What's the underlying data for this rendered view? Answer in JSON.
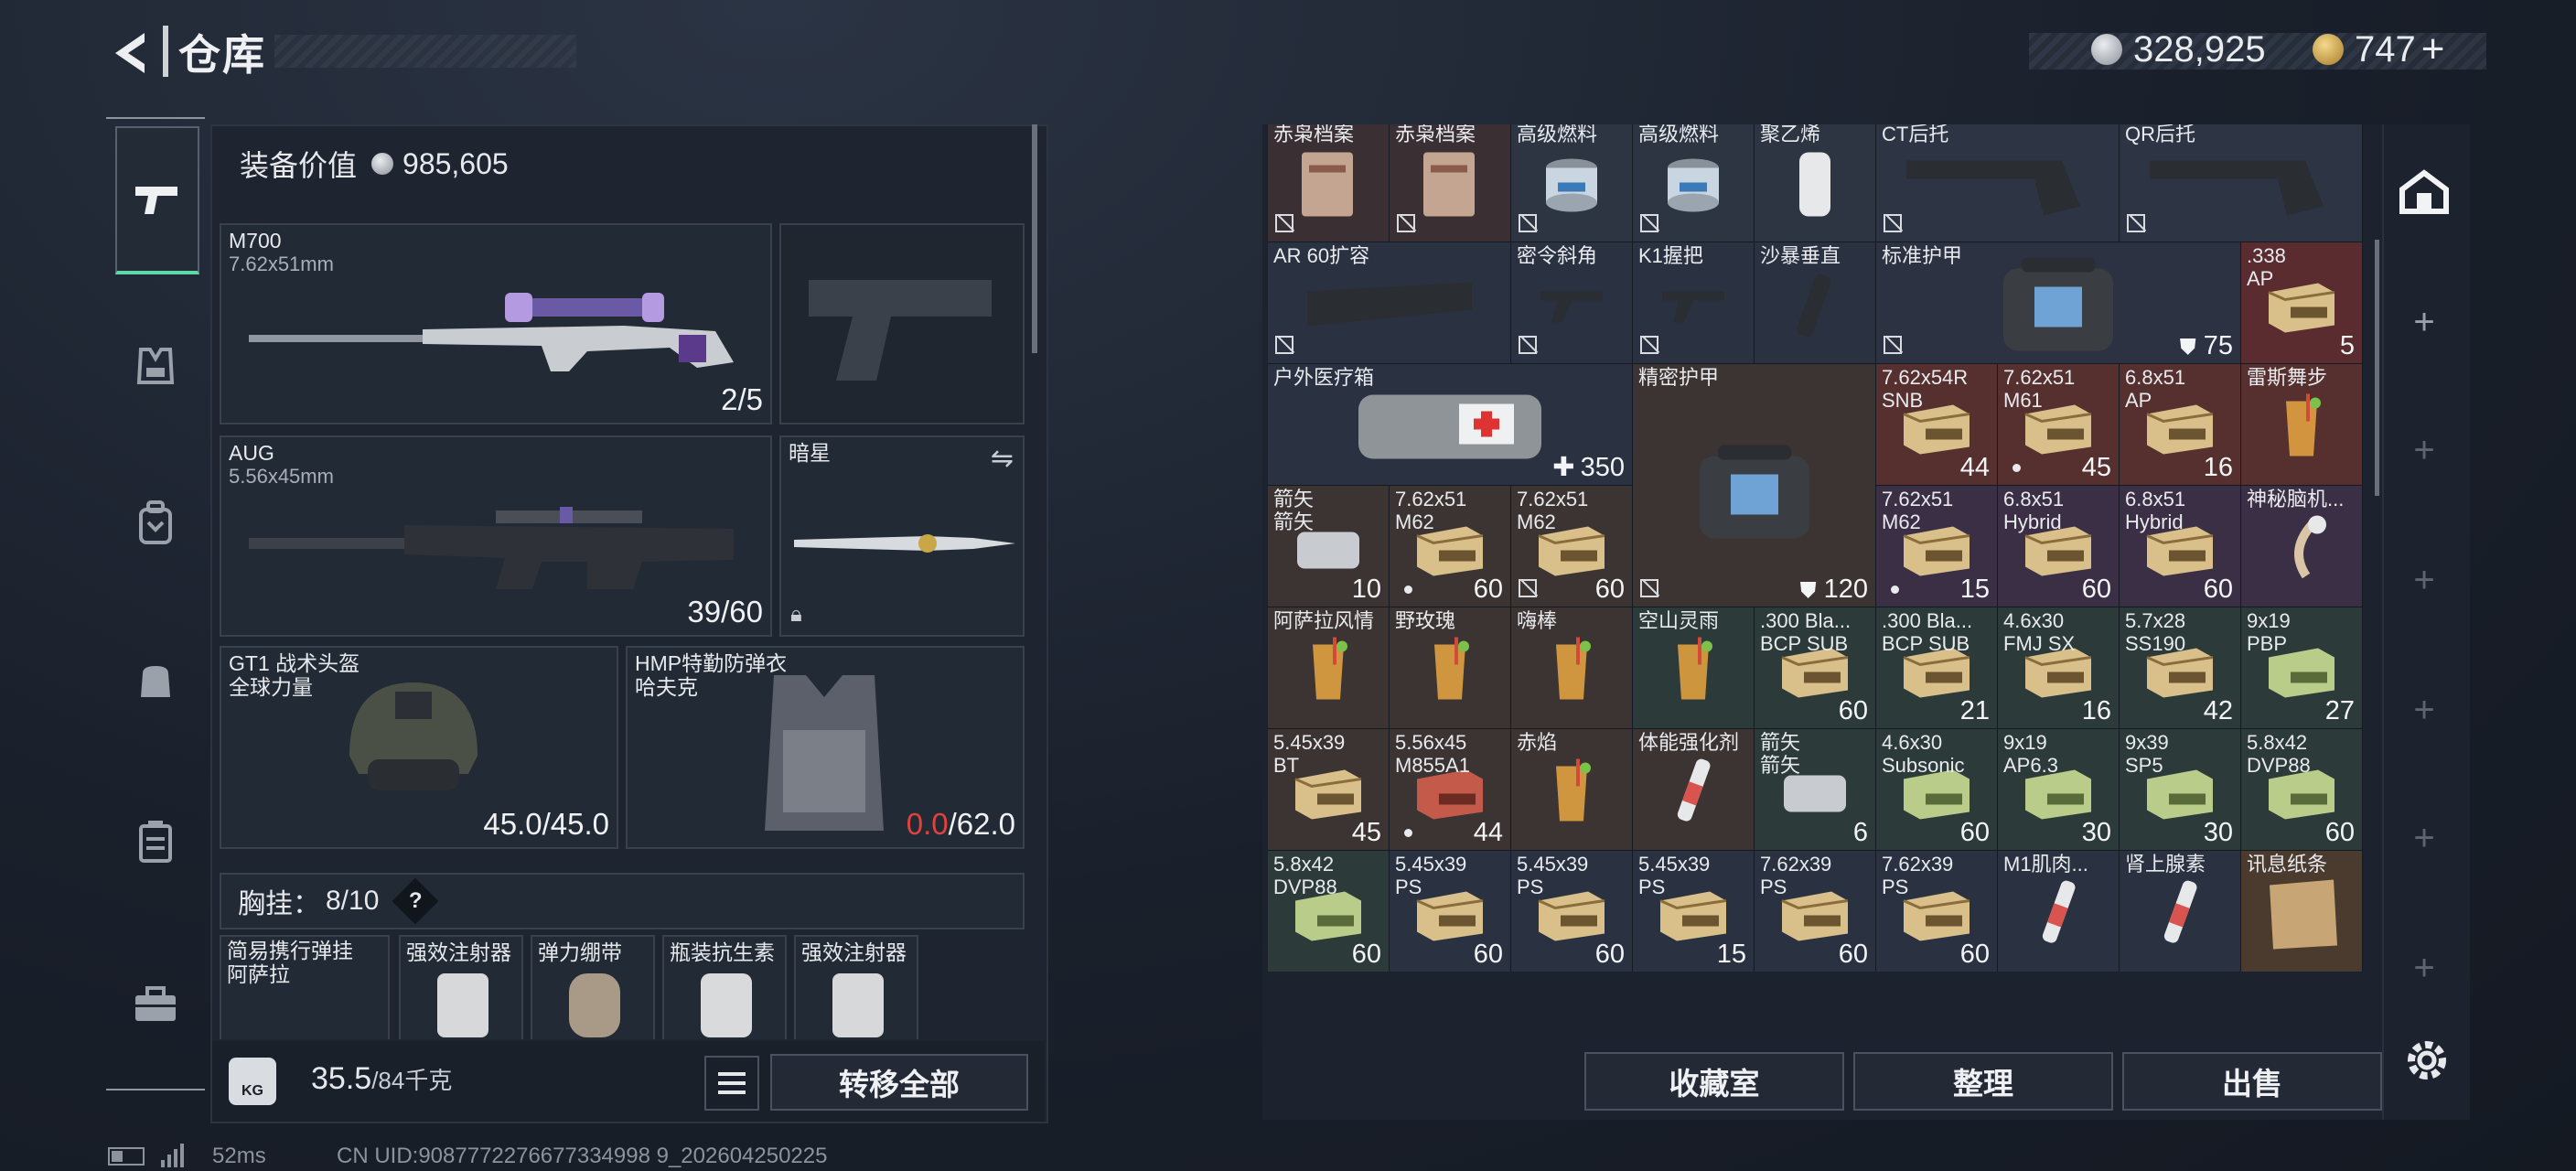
{
  "header": {
    "title": "仓库",
    "currency": {
      "silver": "328,925",
      "gold": "747",
      "plus": "+"
    }
  },
  "gear": {
    "value_label": "装备价值",
    "value": "985,605",
    "primary": {
      "name": "M700",
      "caliber": "7.62x51mm",
      "ammo": "2/5"
    },
    "secondary": {
      "name": "AUG",
      "caliber": "5.56x45mm",
      "ammo": "39/60"
    },
    "melee": {
      "name": "暗星"
    },
    "helmet": {
      "name": "GT1 战术头盔",
      "sub": "全球力量",
      "durability": "45.0/45.0"
    },
    "armor": {
      "name": "HMP特勤防弹衣",
      "sub": "哈夫克",
      "durability_current": "0.0",
      "durability_max": "/62.0"
    },
    "rig": {
      "label": "胸挂：",
      "value": "8/10",
      "help": "?"
    },
    "rig_items": [
      {
        "name": "简易携行弹挂\n阿萨拉"
      },
      {
        "name": "强效注射器"
      },
      {
        "name": "弹力绷带"
      },
      {
        "name": "瓶装抗生素"
      },
      {
        "name": "强效注射器"
      }
    ],
    "weight": "35.5",
    "weight_max": "/84千克",
    "transfer_all": "转移全部"
  },
  "inventory": {
    "rows": [
      [
        {
          "l": "赤枭档案",
          "c": "",
          "m": true,
          "bg": "#3a3034",
          "ico": "doc"
        },
        {
          "l": "赤枭档案",
          "c": "",
          "m": true,
          "bg": "#3a3034",
          "ico": "doc"
        },
        {
          "l": "高级燃料",
          "c": "",
          "m": true,
          "bg": "#2d3542",
          "ico": "can"
        },
        {
          "l": "高级燃料",
          "c": "",
          "m": true,
          "bg": "#2d3542",
          "ico": "can"
        },
        {
          "l": "聚乙烯",
          "c": "",
          "m": false,
          "bg": "#2d3542",
          "ico": "roll"
        },
        {
          "l": "CT后托",
          "c": "",
          "m": true,
          "bg": "#2d3444",
          "ico": "stock",
          "w": 2
        },
        null,
        {
          "l": "QR后托",
          "c": "",
          "m": true,
          "bg": "#2d3444",
          "ico": "stock",
          "w": 2
        },
        null
      ],
      [
        {
          "l": "AR 60扩容",
          "c": "",
          "m": true,
          "bg": "#2a3140",
          "ico": "mag",
          "w": 2
        },
        null,
        {
          "l": "密令斜角",
          "c": "",
          "m": true,
          "bg": "#2a3140",
          "ico": "grip"
        },
        {
          "l": "K1握把",
          "c": "",
          "m": true,
          "bg": "#2a3140",
          "ico": "grip"
        },
        {
          "l": "沙暴垂直",
          "c": "",
          "m": false,
          "bg": "#2a3140",
          "ico": "vgrip"
        },
        {
          "l": "标准护甲",
          "c": "75",
          "m": true,
          "bg": "#2c3242",
          "ico": "armor",
          "w": 3,
          "shield": true
        },
        null,
        null,
        {
          "l": ".338\nAP",
          "c": "5",
          "m": false,
          "bg": "#5a2b2f",
          "ico": "ammobox"
        }
      ],
      [
        {
          "l": "户外医疗箱",
          "c": "350",
          "m": false,
          "bg": "#2a3140",
          "ico": "medkit",
          "w": 3,
          "plus": true
        },
        null,
        null,
        {
          "l": "精密护甲",
          "c": "120",
          "m": true,
          "bg": "#3c3433",
          "ico": "armor",
          "w": 2,
          "h": 2,
          "shield": true
        },
        null,
        {
          "l": "7.62x54R\nSNB",
          "c": "44",
          "m": false,
          "bg": "#55302f",
          "ico": "ammobox"
        },
        {
          "l": "7.62x51\nM61",
          "c": "45",
          "m": false,
          "d": true,
          "bg": "#55302f",
          "ico": "ammobox"
        },
        {
          "l": "6.8x51\nAP",
          "c": "16",
          "m": false,
          "bg": "#55302f",
          "ico": "ammobox"
        },
        {
          "l": "雷斯舞步",
          "c": "",
          "m": false,
          "bg": "#55302f",
          "ico": "drink"
        }
      ],
      [
        {
          "l": "箭矢\n箭矢",
          "c": "10",
          "m": false,
          "bg": "#3c3433",
          "ico": "tin"
        },
        {
          "l": "7.62x51\nM62",
          "c": "60",
          "m": false,
          "d": true,
          "bg": "#3c3433",
          "ico": "ammobox"
        },
        {
          "l": "7.62x51\nM62",
          "c": "60",
          "m": true,
          "bg": "#3c3433",
          "ico": "ammobox"
        },
        null,
        null,
        {
          "l": "7.62x51\nM62",
          "c": "15",
          "m": false,
          "d": true,
          "bg": "#3a2f45",
          "ico": "ammobox"
        },
        {
          "l": "6.8x51\nHybrid",
          "c": "60",
          "m": false,
          "bg": "#3a2f45",
          "ico": "ammobox"
        },
        {
          "l": "6.8x51\nHybrid",
          "c": "60",
          "m": false,
          "bg": "#3a2f45",
          "ico": "ammobox"
        },
        {
          "l": "神秘脑机...",
          "c": "",
          "m": false,
          "bg": "#3a2f45",
          "ico": "cable"
        }
      ],
      [
        {
          "l": "阿萨拉风情",
          "c": "",
          "m": false,
          "bg": "#3c3433",
          "ico": "drink"
        },
        {
          "l": "野玫瑰",
          "c": "",
          "m": false,
          "bg": "#3c3433",
          "ico": "drink"
        },
        {
          "l": "嗨棒",
          "c": "",
          "m": false,
          "bg": "#3c3433",
          "ico": "drink"
        },
        {
          "l": "空山灵雨",
          "c": "",
          "m": false,
          "bg": "#2c3a3a",
          "ico": "drink"
        },
        {
          "l": ".300 Bla...\nBCP SUB",
          "c": "60",
          "m": false,
          "bg": "#2c3a3a",
          "ico": "ammobox"
        },
        {
          "l": ".300 Bla...\nBCP SUB",
          "c": "21",
          "m": false,
          "bg": "#2c3a3a",
          "ico": "ammobox"
        },
        {
          "l": "4.6x30\nFMJ SX",
          "c": "16",
          "m": false,
          "bg": "#2c3a3a",
          "ico": "ammobox"
        },
        {
          "l": "5.7x28\nSS190",
          "c": "42",
          "m": false,
          "bg": "#2c3a3a",
          "ico": "ammobox"
        },
        {
          "l": "9x19\nPBP",
          "c": "27",
          "m": false,
          "bg": "#2c3a3a",
          "ico": "ammogreen"
        }
      ],
      [
        {
          "l": "5.45x39\nBT",
          "c": "45",
          "m": false,
          "bg": "#3c3433",
          "ico": "ammobox"
        },
        {
          "l": "5.56x45\nM855A1",
          "c": "44",
          "m": false,
          "d": true,
          "bg": "#3c3433",
          "ico": "ammored"
        },
        {
          "l": "赤焰",
          "c": "",
          "m": false,
          "bg": "#3c3433",
          "ico": "drink"
        },
        {
          "l": "体能强化剂",
          "c": "",
          "m": false,
          "bg": "#3c3433",
          "ico": "syringe"
        },
        {
          "l": "箭矢\n箭矢",
          "c": "6",
          "m": false,
          "bg": "#2c3a3a",
          "ico": "tin"
        },
        {
          "l": "4.6x30\nSubsonic",
          "c": "60",
          "m": false,
          "bg": "#2c3a3a",
          "ico": "ammogreen"
        },
        {
          "l": "9x19\nAP6.3",
          "c": "30",
          "m": false,
          "bg": "#2c3a3a",
          "ico": "ammogreen"
        },
        {
          "l": "9x39\nSP5",
          "c": "30",
          "m": false,
          "bg": "#2c3a3a",
          "ico": "ammogreen"
        },
        {
          "l": "5.8x42\nDVP88",
          "c": "60",
          "m": false,
          "bg": "#2c3a3a",
          "ico": "ammogreen"
        }
      ],
      [
        {
          "l": "5.8x42\nDVP88",
          "c": "60",
          "m": false,
          "bg": "#2c3a3a",
          "ico": "ammogreen"
        },
        {
          "l": "5.45x39\nPS",
          "c": "60",
          "m": false,
          "bg": "#2a3140",
          "ico": "ammobox"
        },
        {
          "l": "5.45x39\nPS",
          "c": "60",
          "m": false,
          "bg": "#2a3140",
          "ico": "ammobox"
        },
        {
          "l": "5.45x39\nPS",
          "c": "15",
          "m": false,
          "bg": "#2a3140",
          "ico": "ammobox"
        },
        {
          "l": "7.62x39\nPS",
          "c": "60",
          "m": false,
          "bg": "#2a3140",
          "ico": "ammobox"
        },
        {
          "l": "7.62x39\nPS",
          "c": "60",
          "m": false,
          "bg": "#2a3140",
          "ico": "ammobox"
        },
        {
          "l": "M1肌肉...",
          "c": "",
          "m": false,
          "bg": "#2a3140",
          "ico": "syringe"
        },
        {
          "l": "肾上腺素",
          "c": "",
          "m": false,
          "bg": "#2a3140",
          "ico": "syringe"
        },
        {
          "l": "讯息纸条",
          "c": "",
          "m": false,
          "bg": "#4a3b2e",
          "ico": "paper"
        }
      ]
    ]
  },
  "actions": {
    "collection": "收藏室",
    "sort": "整理",
    "sell": "出售"
  },
  "footer": {
    "ping": "52ms",
    "uid": "CN UID:9087772276677334998 9_202604250225"
  }
}
